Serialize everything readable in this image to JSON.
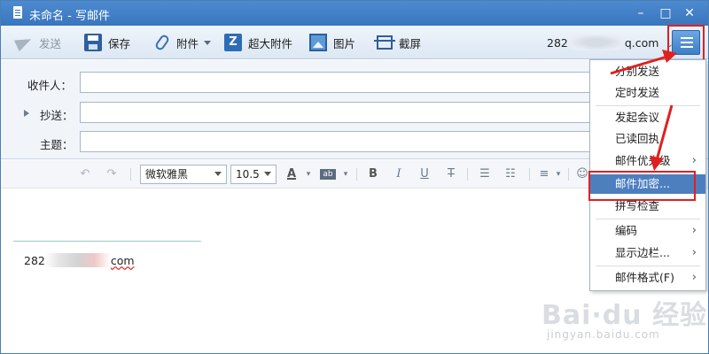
{
  "window": {
    "title": "未命名 - 写邮件",
    "controls": {
      "minimize": "–",
      "maximize": "□",
      "close": "✕"
    }
  },
  "toolbar": {
    "send": "发送",
    "save": "保存",
    "attach": "附件",
    "big_attach": "超大附件",
    "picture": "图片",
    "screenshot": "截屏",
    "account_prefix": "282",
    "account_suffix": "q.com",
    "account_caret": "⌄"
  },
  "fields": {
    "to_label": "收件人：",
    "cc_label": "抄送：",
    "subject_label": "主题：",
    "to_value": "",
    "cc_value": "",
    "subject_value": ""
  },
  "format": {
    "font": "微软雅黑",
    "size": "10.5",
    "bold": "B",
    "italic": "I",
    "underline": "U",
    "strike": "T",
    "font_color": "A",
    "bg_color": "ab"
  },
  "editor": {
    "signature_prefix": "282",
    "signature_suffix": "com"
  },
  "menu": {
    "items": [
      {
        "label": "分别发送"
      },
      {
        "label": "定时发送"
      },
      {
        "label": "发起会议"
      },
      {
        "label": "已读回执"
      },
      {
        "label": "邮件优先级",
        "sub": "›"
      },
      {
        "label": "邮件加密...",
        "highlighted": true
      },
      {
        "label": "拼写检查"
      },
      {
        "label": "编码",
        "sub": "›"
      },
      {
        "label": "显示边栏...",
        "sub": "›"
      },
      {
        "label": "邮件格式(F)",
        "sub": "›"
      }
    ]
  },
  "watermark": {
    "brand": "Bai·du 经验",
    "url": "jingyan.baidu.com"
  },
  "colors": {
    "accent": "#3a76bd",
    "highlight": "#4d7fbf",
    "annotation": "#e02020"
  }
}
